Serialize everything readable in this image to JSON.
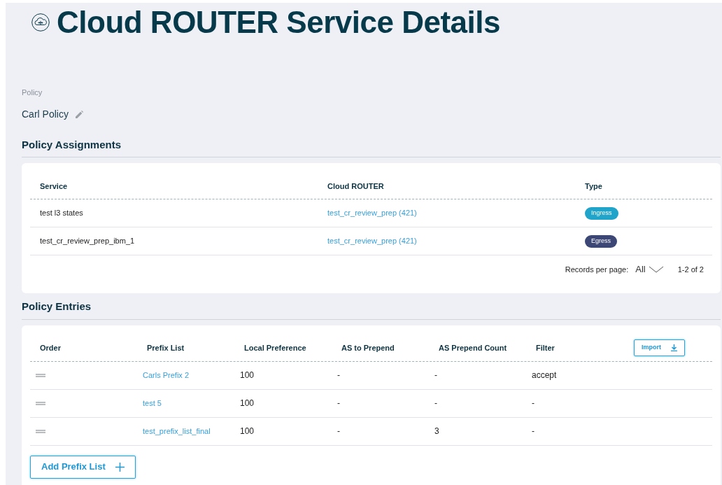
{
  "page_title": "Cloud ROUTER Service Details",
  "policy": {
    "label": "Policy",
    "name": "Carl Policy"
  },
  "assignments": {
    "heading": "Policy Assignments",
    "columns": [
      "Service",
      "Cloud ROUTER",
      "Type"
    ],
    "rows": [
      {
        "service": "test l3 states",
        "cloud_router": "test_cr_review_prep (421)",
        "type": "Ingress",
        "color": "#21a4c9"
      },
      {
        "service": "test_cr_review_prep_ibm_1",
        "cloud_router": "test_cr_review_prep (421)",
        "type": "Egress",
        "color": "#3d4775"
      }
    ],
    "pagination": {
      "label": "Records per page:",
      "value": "All",
      "range": "1-2 of 2"
    }
  },
  "entries": {
    "heading": "Policy Entries",
    "columns": [
      "Order",
      "Prefix List",
      "Local Preference",
      "AS to Prepend",
      "AS Prepend Count",
      "Filter"
    ],
    "import_button": "Import",
    "rows": [
      {
        "prefix_list": "Carls Prefix 2",
        "local_preference": "100",
        "as_to_prepend": "-",
        "as_prepend_count": "-",
        "filter": "accept"
      },
      {
        "prefix_list": "test 5",
        "local_preference": "100",
        "as_to_prepend": "-",
        "as_prepend_count": "-",
        "filter": "-"
      },
      {
        "prefix_list": "test_prefix_list_final",
        "local_preference": "100",
        "as_to_prepend": "-",
        "as_prepend_count": "3",
        "filter": "-"
      }
    ],
    "add_button": "Add Prefix List"
  }
}
